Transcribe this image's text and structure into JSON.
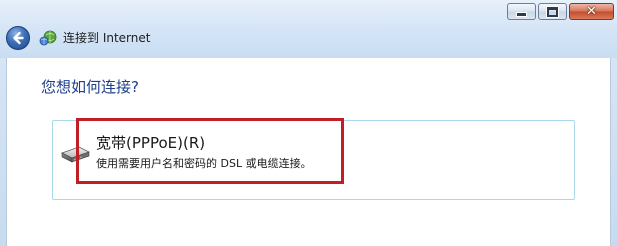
{
  "window": {
    "caption_buttons": {
      "minimize_icon": "minimize-icon",
      "maximize_icon": "maximize-icon",
      "close_icon": "close-icon",
      "close_glyph": "✕"
    }
  },
  "header": {
    "back_icon": "back-arrow-icon",
    "app_icon": "network-globe-icon",
    "title": "连接到 Internet"
  },
  "main": {
    "question": "您想如何连接?",
    "options": [
      {
        "icon": "broadband-modem-icon",
        "title": "宽带(PPPoE)(R)",
        "description": "使用需要用户名和密码的 DSL 或电缆连接。",
        "highlighted": true
      }
    ]
  },
  "colors": {
    "highlight": "#c01f26",
    "question_text": "#1e3f8a",
    "card_border": "#a8d8ea"
  }
}
